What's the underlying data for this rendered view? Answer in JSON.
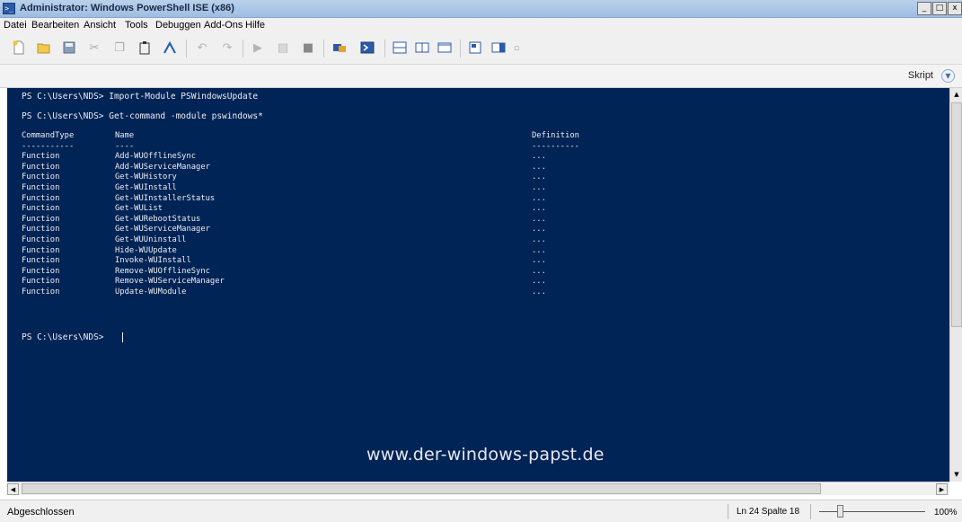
{
  "window": {
    "title": "Administrator: Windows PowerShell ISE (x86)",
    "controls": {
      "minimize": "_",
      "maximize": "□",
      "close": "x"
    }
  },
  "menu": [
    "Datei",
    "Bearbeiten",
    "Ansicht",
    "Tools",
    "Debuggen",
    "Add-Ons",
    "Hilfe"
  ],
  "toolbar": {
    "icons": [
      "new-file-icon",
      "open-folder-icon",
      "save-icon",
      "cut-icon",
      "copy-icon",
      "paste-icon",
      "clear-console-icon",
      "undo-icon",
      "redo-icon",
      "run-script-icon",
      "run-selection-icon",
      "stop-icon",
      "remote-powershell-icon",
      "powershell-icon",
      "layout-top-icon",
      "layout-side-icon",
      "layout-max-icon",
      "show-commands-icon",
      "show-addon-icon",
      "more-icon"
    ]
  },
  "script_bar": {
    "label": "Skript"
  },
  "console": {
    "lines": [
      "PS C:\\Users\\NDS> Import-Module PSWindowsUpdate",
      "PS C:\\Users\\NDS> Get-command -module pswindows*"
    ],
    "table": {
      "headers": [
        "CommandType",
        "Name",
        "Definition"
      ],
      "underlines": [
        "-----------",
        "----",
        "----------"
      ],
      "rows": [
        [
          "Function",
          "Add-WUOfflineSync",
          "..."
        ],
        [
          "Function",
          "Add-WUServiceManager",
          "..."
        ],
        [
          "Function",
          "Get-WUHistory",
          "..."
        ],
        [
          "Function",
          "Get-WUInstall",
          "..."
        ],
        [
          "Function",
          "Get-WUInstallerStatus",
          "..."
        ],
        [
          "Function",
          "Get-WUList",
          "..."
        ],
        [
          "Function",
          "Get-WURebootStatus",
          "..."
        ],
        [
          "Function",
          "Get-WUServiceManager",
          "..."
        ],
        [
          "Function",
          "Get-WUUninstall",
          "..."
        ],
        [
          "Function",
          "Hide-WUUpdate",
          "..."
        ],
        [
          "Function",
          "Invoke-WUInstall",
          "..."
        ],
        [
          "Function",
          "Remove-WUOfflineSync",
          "..."
        ],
        [
          "Function",
          "Remove-WUServiceManager",
          "..."
        ],
        [
          "Function",
          "Update-WUModule",
          "..."
        ]
      ]
    },
    "prompt": "PS C:\\Users\\NDS> ",
    "watermark": "www.der-windows-papst.de"
  },
  "statusbar": {
    "status": "Abgeschlossen",
    "position": "Ln 24  Spalte 18",
    "zoom": "100%",
    "zoom_level": 1.0
  },
  "colors": {
    "console_bg": "#012456",
    "console_fg": "#eeedf0"
  }
}
